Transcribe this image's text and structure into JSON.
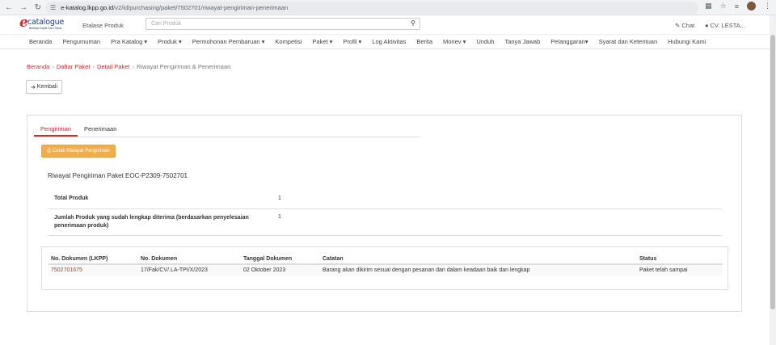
{
  "browser": {
    "url_host": "e-katalog.lkpp.go.id",
    "url_path": "/v2/id/purchasing/paket/7502701/riwayat-pengiriman-penerimaan"
  },
  "header": {
    "logo_text": "catalogue",
    "logo_sub": "Belanja Cepat Cara Tepat",
    "etalase_label": "Etalase Produk",
    "search_placeholder": "Cari Produk",
    "chat_label": "Chat",
    "user_label": "CV. LESTA..."
  },
  "menu": [
    "Beranda",
    "Pengumuman",
    "Pra Katalog ▾",
    "Produk ▾",
    "Permohonan Pembaruan ▾",
    "Kompetisi",
    "Paket ▾",
    "Profil ▾",
    "Log Aktivitas",
    "Berita",
    "Monev ▾",
    "Unduh",
    "Tanya Jawab",
    "Pelanggaran▾",
    "Syarat dan Ketentuan",
    "Hubungi Kami"
  ],
  "breadcrumb": {
    "items": [
      "Beranda",
      "Daftar Paket",
      "Detail Paket"
    ],
    "current": "Riwayat Pengiriman & Penerimaan"
  },
  "back_label": "Kembali",
  "tabs": [
    "Pengiriman",
    "Penerimaan"
  ],
  "print_label": "Cetak Riwayat Pengiriman",
  "paket_title": "Riwayat Pengiriman Paket EOC-P2309-7502701",
  "info": [
    {
      "label": "Total Produk",
      "value": "1"
    },
    {
      "label": "Jumlah Produk yang sudah lengkap diterima (berdasarkan penyelesaian penerimaan produk)",
      "value": "1"
    }
  ],
  "table": {
    "headers": [
      "No. Dokumen (LKPP)",
      "No. Dokumen",
      "Tanggal Dokumen",
      "Catatan",
      "Status"
    ],
    "rows": [
      [
        "7502701675",
        "17/Fak/CV/.LA-TPI/X/2023",
        "02 Oktober 2023",
        "Barang akan dikirim sesuai dengan pesanan dan dalam keadaan baik dan lengkap",
        "Paket telah sampai"
      ]
    ]
  }
}
